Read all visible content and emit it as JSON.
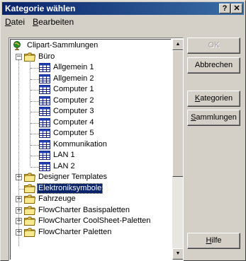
{
  "window": {
    "title": "Kategorie wählen",
    "help_glyph": "?",
    "close_glyph": "✕"
  },
  "menu": {
    "items": [
      "Datei",
      "Bearbeiten"
    ]
  },
  "tree": {
    "root": "Clipart-Sammlungen",
    "buero": {
      "label": "Büro",
      "children": [
        "Allgemein 1",
        "Allgemein 2",
        "Computer 1",
        "Computer 2",
        "Computer 3",
        "Computer 4",
        "Computer 5",
        "Kommunikation",
        "LAN 1",
        "LAN 2"
      ]
    },
    "rest": [
      {
        "label": "Designer Templates",
        "expander": "+"
      },
      {
        "label": "Elektroniksymbole",
        "expander": ""
      },
      {
        "label": "Fahrzeuge",
        "expander": "+"
      },
      {
        "label": "FlowCharter Basispaletten",
        "expander": "+"
      },
      {
        "label": "FlowCharter CoolSheet-Paletten",
        "expander": "+"
      },
      {
        "label": "FlowCharter Paletten",
        "expander": "+"
      }
    ],
    "selected": "Elektroniksymbole"
  },
  "buttons": {
    "ok": "OK",
    "cancel": "Abbrechen",
    "categories": "Kategorien",
    "collections": "Sammlungen",
    "help": "Hilfe"
  },
  "colors": {
    "titlebar_start": "#0a246a",
    "titlebar_end": "#3a6ea5",
    "face": "#d4d0c8",
    "selection": "#0a246a"
  }
}
